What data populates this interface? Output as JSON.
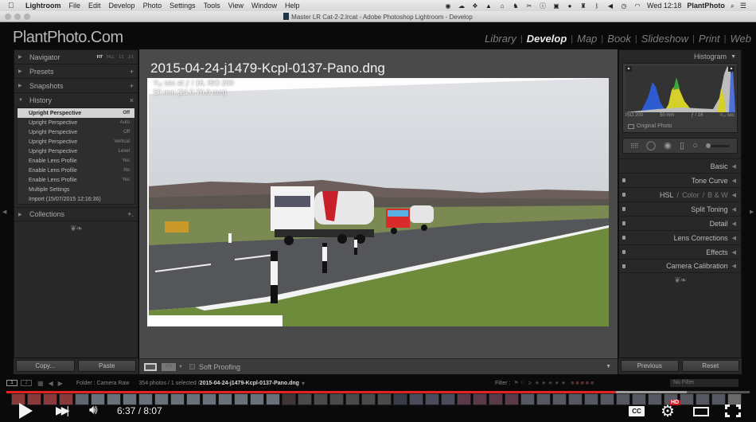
{
  "menubar": {
    "apple": "",
    "items": [
      "Lightroom",
      "File",
      "Edit",
      "Develop",
      "Photo",
      "Settings",
      "Tools",
      "View",
      "Window",
      "Help"
    ],
    "status_icons": [
      "creative-cloud-icon",
      "cloud-icon",
      "dropbox-icon",
      "drive-icon",
      "home-icon",
      "evernote-icon",
      "tool-icon",
      "info-icon",
      "camera-icon",
      "hat-icon",
      "binoculars-icon",
      "bluetooth-icon",
      "volume-icon",
      "time-machine-icon",
      "wifi-icon"
    ],
    "clock": "Wed 12:18",
    "user": "PlantPhoto",
    "search": "⌕",
    "list": "☰"
  },
  "window": {
    "title": "Master LR Cat-2-2.lrcat - Adobe Photoshop Lightroom - Develop"
  },
  "identity_plate": "PlantPhoto.Com",
  "modules": [
    {
      "label": "Library",
      "active": false
    },
    {
      "label": "Develop",
      "active": true
    },
    {
      "label": "Map",
      "active": false
    },
    {
      "label": "Book",
      "active": false
    },
    {
      "label": "Slideshow",
      "active": false
    },
    {
      "label": "Print",
      "active": false
    },
    {
      "label": "Web",
      "active": false
    }
  ],
  "left_panel": {
    "navigator": {
      "label": "Navigator",
      "zoom_options": [
        "FIT",
        "FILL",
        "1:1",
        "3:1"
      ],
      "active_zoom": "FIT"
    },
    "presets": {
      "label": "Presets",
      "action": "+"
    },
    "snapshots": {
      "label": "Snapshots",
      "action": "+"
    },
    "history": {
      "label": "History",
      "action": "×",
      "items": [
        {
          "name": "Upright Perspective",
          "value": "Off",
          "selected": true
        },
        {
          "name": "Upright Perspective",
          "value": "Auto",
          "selected": false
        },
        {
          "name": "Upright Perspective",
          "value": "Off",
          "selected": false
        },
        {
          "name": "Upright Perspective",
          "value": "Vertical",
          "selected": false
        },
        {
          "name": "Upright Perspective",
          "value": "Level",
          "selected": false
        },
        {
          "name": "Enable Lens Profile",
          "value": "Yes",
          "selected": false
        },
        {
          "name": "Enable Lens Profile",
          "value": "No",
          "selected": false
        },
        {
          "name": "Enable Lens Profile",
          "value": "Yes",
          "selected": false
        },
        {
          "name": "Multiple Settings",
          "value": "",
          "selected": false
        },
        {
          "name": "Import (15/07/2015 12:16:36)",
          "value": "",
          "selected": false
        }
      ]
    },
    "collections": {
      "label": "Collections",
      "action": "+."
    },
    "copy_button": "Copy...",
    "paste_button": "Paste"
  },
  "center": {
    "filename": "2015-04-24-j1479-Kcpl-0137-Pano.dng",
    "exif_line1": "¹⁄₁₃ sec at ƒ / 16, ISO 200",
    "exif_line2": "50 mm (24.0-70.0 mm)",
    "toolbar": {
      "compare_label": "Y|Y",
      "soft_proofing_label": "Soft Proofing",
      "soft_proofing_checked": false
    }
  },
  "right_panel": {
    "histogram": {
      "label": "Histogram",
      "iso": "ISO 200",
      "focal": "50 mm",
      "aperture": "ƒ / 16",
      "shutter": "¹⁄₁₃ sec",
      "original_photo_label": "Original Photo"
    },
    "sections": [
      {
        "label": "Basic",
        "has_switch": false
      },
      {
        "label": "Tone Curve",
        "has_switch": true
      },
      {
        "label": "HSL",
        "label_2": "Color",
        "label_3": "B & W",
        "has_switch": true,
        "multi": true
      },
      {
        "label": "Split Toning",
        "has_switch": true
      },
      {
        "label": "Detail",
        "has_switch": true
      },
      {
        "label": "Lens Corrections",
        "has_switch": true
      },
      {
        "label": "Effects",
        "has_switch": true
      },
      {
        "label": "Camera Calibration",
        "has_switch": true
      }
    ],
    "previous_button": "Previous",
    "reset_button": "Reset"
  },
  "filmstrip": {
    "screen1": "1",
    "screen2": "2",
    "folder": "Folder : Camera Raw",
    "count": "354 photos / 1 selected /",
    "filename": "2015-04-24-j1479-Kcpl-0137-Pano.dng",
    "filter_label": "Filter :",
    "rating_op": "≥",
    "stars": "★★★★★",
    "no_filter": "No Filter"
  },
  "video": {
    "current_time": "6:37",
    "duration": "8:07",
    "time_display": "6:37 / 8:07",
    "played_fraction": 0.82,
    "loaded_fraction": 0.915,
    "cc_label": "CC",
    "hd_label": "HD"
  }
}
